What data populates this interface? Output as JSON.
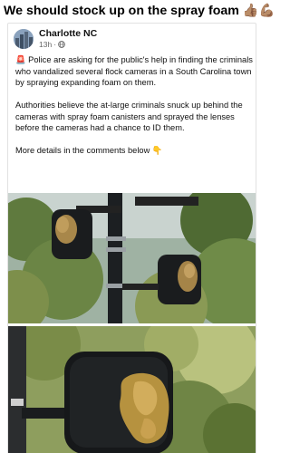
{
  "headline": {
    "text": "We should stock up on the spray foam",
    "emoji": "👍🏽💪🏽"
  },
  "post": {
    "page_name": "Charlotte NC",
    "time": "13h",
    "audience_icon": "globe-icon",
    "alert_emoji": "🚨",
    "paragraphs": [
      "Police are asking for the public's help in finding the criminals who vandalized several flock cameras in a South Carolina town by spraying expanding foam on them.",
      "Authorities believe the at-large criminals snuck up behind the cameras with spray foam canisters and sprayed the lenses before the cameras had a chance to ID them.",
      "More details in the comments below"
    ],
    "pointing_emoji": "👇",
    "photos": [
      {
        "subject": "two flock cameras on a pole covered in spray foam"
      },
      {
        "subject": "close-up of a flock camera lens covered in spray foam"
      }
    ]
  }
}
